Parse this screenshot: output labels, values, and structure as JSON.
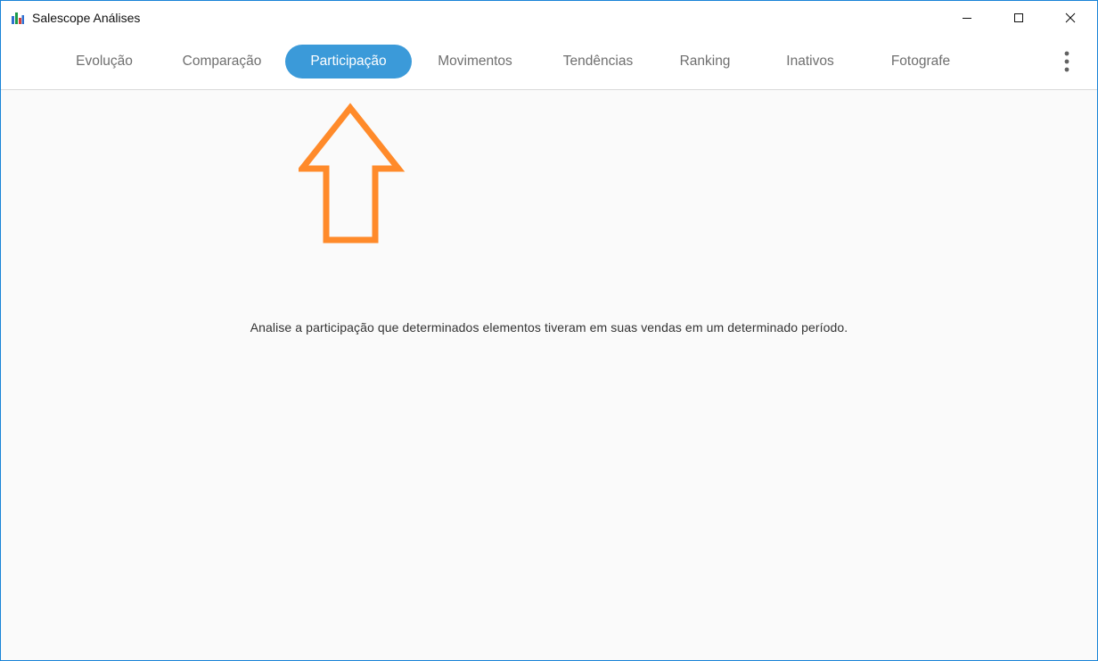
{
  "window": {
    "title": "Salescope Análises"
  },
  "tabs": [
    {
      "label": "Evolução",
      "active": false
    },
    {
      "label": "Comparação",
      "active": false
    },
    {
      "label": "Participação",
      "active": true
    },
    {
      "label": "Movimentos",
      "active": false
    },
    {
      "label": "Tendências",
      "active": false
    },
    {
      "label": "Ranking",
      "active": false
    },
    {
      "label": "Inativos",
      "active": false
    },
    {
      "label": "Fotografe",
      "active": false
    }
  ],
  "content": {
    "description": "Analise a participação que determinados elementos tiveram em suas vendas em um determinado período."
  },
  "colors": {
    "active_tab": "#3b9ad9",
    "annotation_arrow": "#ff8a2a",
    "window_border": "#1883d7"
  },
  "icons": {
    "app": "bar-chart-icon",
    "minimize": "minimize-icon",
    "maximize": "maximize-icon",
    "close": "close-icon",
    "more": "more-vertical-icon",
    "annotation": "up-arrow-icon"
  }
}
